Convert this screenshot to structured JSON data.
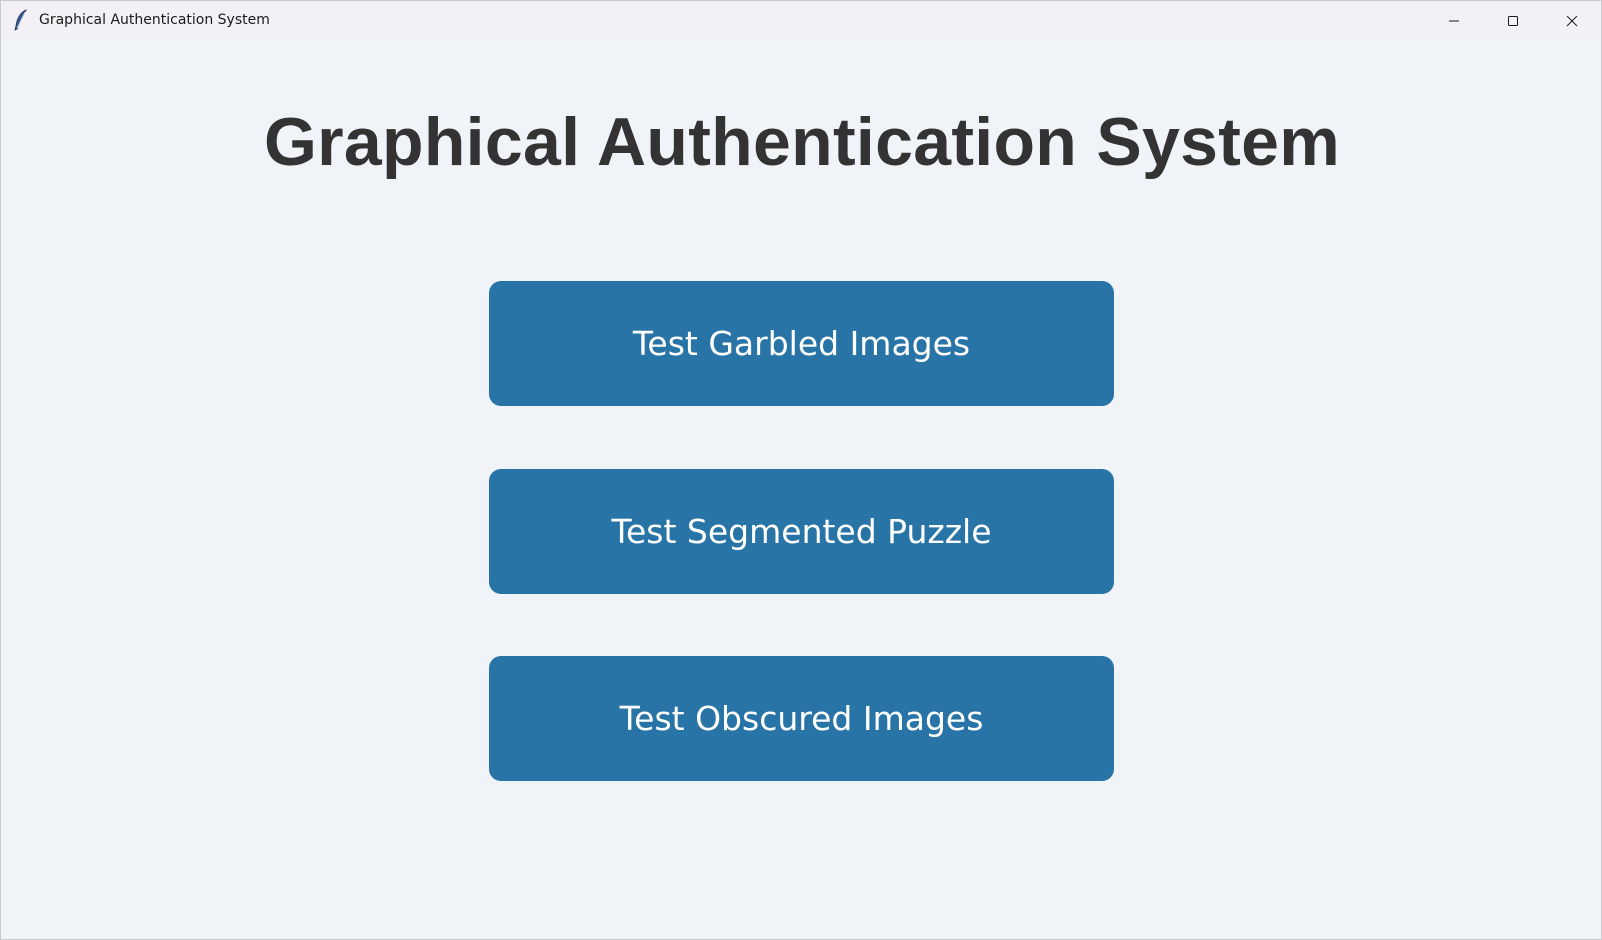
{
  "window": {
    "title": "Graphical Authentication System",
    "icon": "feather-icon",
    "controls": [
      "minimize-icon",
      "maximize-icon",
      "close-icon"
    ]
  },
  "main": {
    "heading": "Graphical Authentication System",
    "buttons": [
      {
        "label": "Test Garbled Images"
      },
      {
        "label": "Test Segmented Puzzle"
      },
      {
        "label": "Test Obscured Images"
      }
    ]
  },
  "colors": {
    "background": "#f0f4f8",
    "titlebar": "#f3f0f6",
    "button": "#2874a6",
    "button_text": "#ffffff",
    "heading_text": "#333333"
  }
}
